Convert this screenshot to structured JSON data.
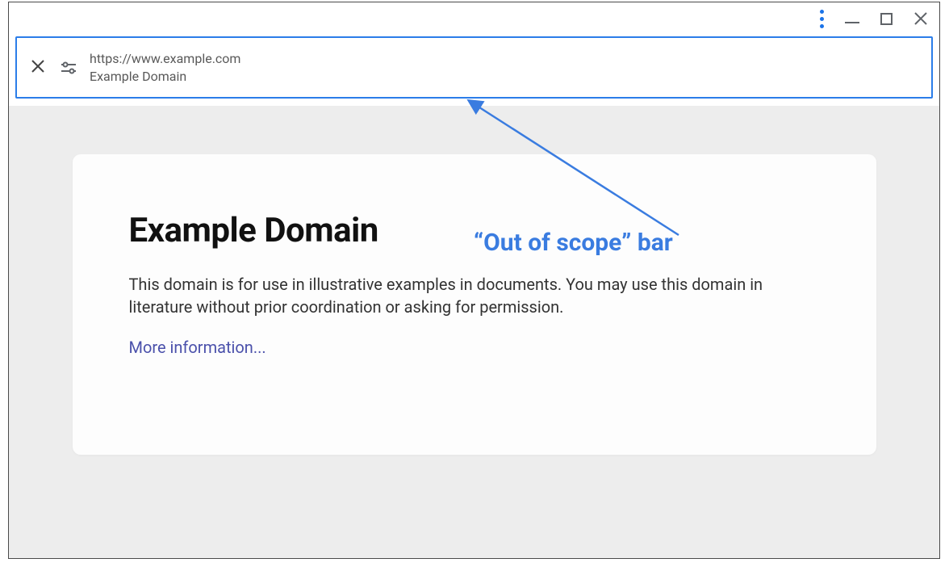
{
  "scopeBar": {
    "url": "https://www.example.com",
    "title": "Example Domain"
  },
  "page": {
    "heading": "Example Domain",
    "body": "This domain is for use in illustrative examples in documents. You may use this domain in literature without prior coordination or asking for permission.",
    "linkText": "More information..."
  },
  "annotation": {
    "label": "“Out of scope” bar"
  }
}
